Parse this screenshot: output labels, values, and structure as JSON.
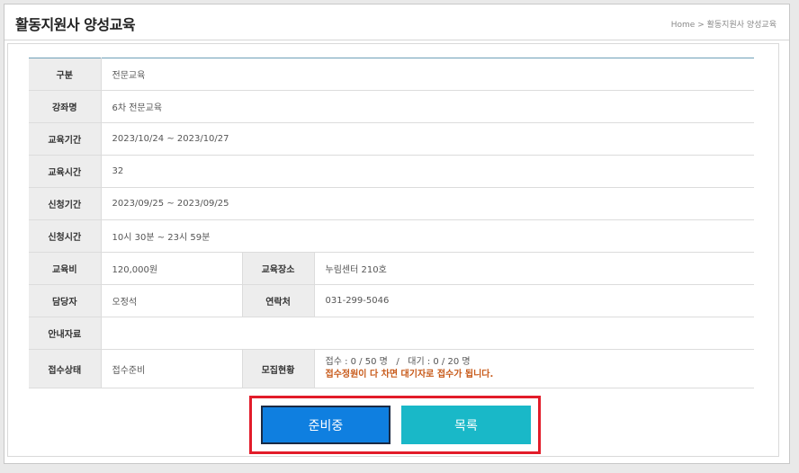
{
  "header": {
    "title": "활동지원사 양성교육",
    "breadcrumb": "Home > 활동지원사 양성교육"
  },
  "rows": {
    "division": {
      "label": "구분",
      "value": "전문교육"
    },
    "course_name": {
      "label": "강좌명",
      "value": "6차 전문교육"
    },
    "edu_period": {
      "label": "교육기간",
      "value": "2023/10/24 ~ 2023/10/27"
    },
    "edu_hours": {
      "label": "교육시간",
      "value": "32"
    },
    "apply_period": {
      "label": "신청기간",
      "value": "2023/09/25 ~ 2023/09/25"
    },
    "apply_time": {
      "label": "신청시간",
      "value": "10시 30분 ~ 23시 59분"
    },
    "fee": {
      "label": "교육비",
      "value": "120,000원"
    },
    "place": {
      "label": "교육장소",
      "value": "누림센터 210호"
    },
    "manager": {
      "label": "담당자",
      "value": "오정석"
    },
    "contact": {
      "label": "연락처",
      "value": "031-299-5046"
    },
    "guide": {
      "label": "안내자료",
      "value": ""
    },
    "status": {
      "label": "접수상태",
      "value": "접수준비"
    },
    "recruit": {
      "label": "모집현황",
      "counts": "접수 : 0 / 50 명   /   대기 : 0 / 20 명",
      "notice": "접수정원이 다 차면 대기자로 접수가 됩니다."
    }
  },
  "buttons": {
    "ready": "준비중",
    "list": "목록"
  },
  "colors": {
    "ready_button": "#0f7fe0",
    "list_button": "#19b8c8",
    "highlight_border": "#e21c2a",
    "notice_text": "#c85a1a"
  }
}
